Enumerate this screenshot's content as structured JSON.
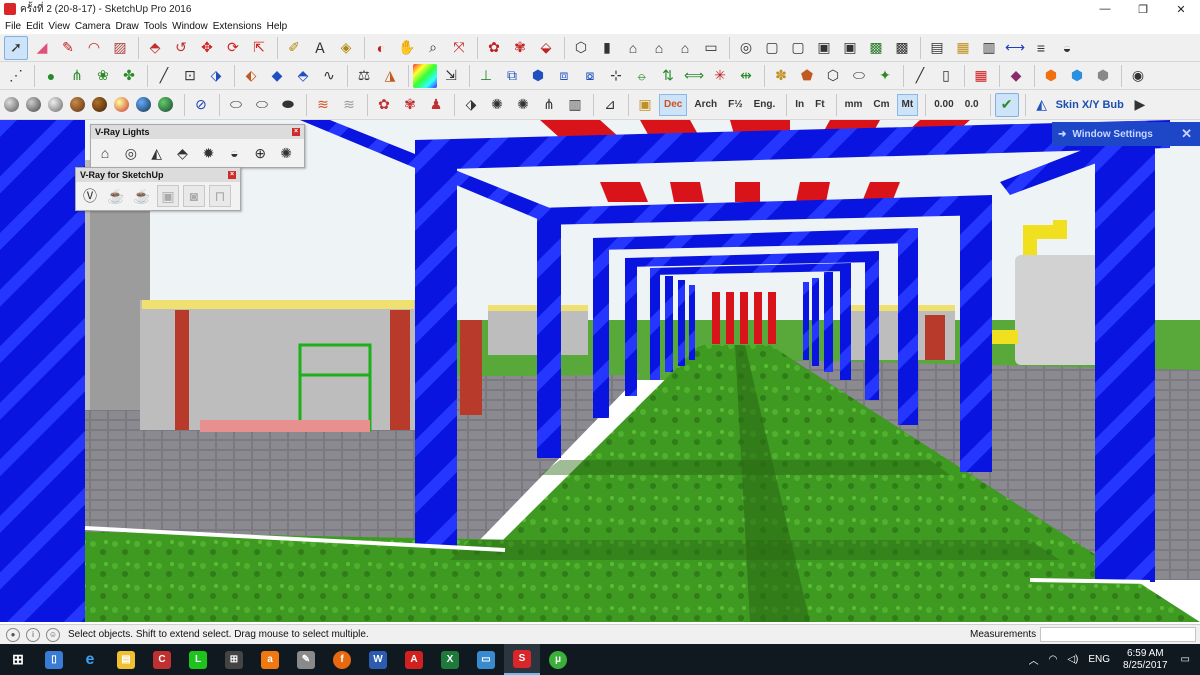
{
  "window": {
    "title": "ครั้งที่ 2 (20-8-17) - SketchUp Pro 2016",
    "minimize": "—",
    "maximize": "❐",
    "close": "✕"
  },
  "menu": [
    "File",
    "Edit",
    "View",
    "Camera",
    "Draw",
    "Tools",
    "Window",
    "Extensions",
    "Help"
  ],
  "toolbar": {
    "unit_buttons": [
      "Dec",
      "Arch",
      "F½",
      "Eng.",
      "In",
      "Ft",
      "mm",
      "Cm",
      "Mt",
      "0.00",
      "0.0"
    ],
    "skin_label": "Skin X/Y Bub"
  },
  "vray_lights": {
    "title": "V-Ray Lights",
    "icons": [
      "rect-light-icon",
      "sphere-light-icon",
      "spot-light-icon",
      "ies-light-icon",
      "omni-light-icon",
      "dome-light-icon",
      "mesh-light-icon",
      "sun-light-icon"
    ]
  },
  "vray_sketchup": {
    "title": "V-Ray for SketchUp",
    "icons": [
      "vray-logo-icon",
      "teapot-render-icon",
      "teapot-interactive-icon",
      "frame-buffer-icon",
      "camera-render-icon",
      "lock-icon"
    ]
  },
  "window_settings": {
    "label": "Window Settings"
  },
  "statusbar": {
    "hint": "Select objects. Shift to extend select. Drag mouse to select multiple.",
    "measurements_label": "Measurements",
    "measurements_value": ""
  },
  "taskbar": {
    "apps": [
      "start-icon",
      "desktop-icon",
      "edge-icon",
      "explorer-icon",
      "ccleaner-icon",
      "line-icon",
      "store-icon",
      "avast-icon",
      "paint-icon",
      "firefox-icon",
      "word-icon",
      "acrobat-icon",
      "excel-icon",
      "photos-icon",
      "sketchup-icon",
      "torrent-icon"
    ],
    "lang": "ENG",
    "time": "6:59 AM",
    "date": "8/25/2017"
  },
  "colors": {
    "steel": "#0a14e0",
    "red": "#d8141a",
    "grass": "#3f9a22",
    "paving": "#7a7a80",
    "sky": "#eef3f6"
  }
}
